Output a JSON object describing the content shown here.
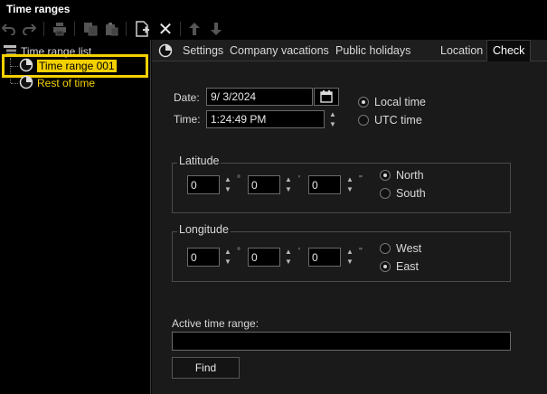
{
  "window": {
    "title": "Time ranges"
  },
  "toolbar": {
    "undo_icon": "undo-icon",
    "redo_icon": "redo-icon",
    "print_icon": "printer-icon",
    "copy_icon": "copy-icon",
    "paste_icon": "paste-icon",
    "new_icon": "new-document-icon",
    "delete_icon": "close-icon",
    "up_icon": "arrow-up-icon",
    "down_icon": "arrow-down-icon"
  },
  "tree": {
    "root_label": "Time range list",
    "items": [
      {
        "label": "Time range 001",
        "selected": true
      },
      {
        "label": "Rest of time",
        "selected": false
      }
    ]
  },
  "tabs": [
    {
      "label": "Settings"
    },
    {
      "label": "Company vacations"
    },
    {
      "label": "Public holidays"
    },
    {
      "label": "Location"
    },
    {
      "label": "Check",
      "active": true
    }
  ],
  "check": {
    "date_label": "Date:",
    "date_value": "9/  3/2024",
    "time_label": "Time:",
    "time_value": "1:24:49 PM",
    "local_time": "Local time",
    "utc_time": "UTC time",
    "time_mode": "local",
    "latitude": {
      "title": "Latitude",
      "deg": "0",
      "min": "0",
      "sec": "0",
      "deg_unit": "°",
      "min_unit": "'",
      "sec_unit": "''",
      "north": "North",
      "south": "South",
      "selected": "north"
    },
    "longitude": {
      "title": "Longitude",
      "deg": "0",
      "min": "0",
      "sec": "0",
      "deg_unit": "°",
      "min_unit": "'",
      "sec_unit": "''",
      "west": "West",
      "east": "East",
      "selected": "east"
    },
    "active_label": "Active time range:",
    "active_value": "",
    "find_button": "Find"
  },
  "colors": {
    "accent": "#f4d000",
    "background": "#1a1a1a",
    "panel": "#000000"
  }
}
